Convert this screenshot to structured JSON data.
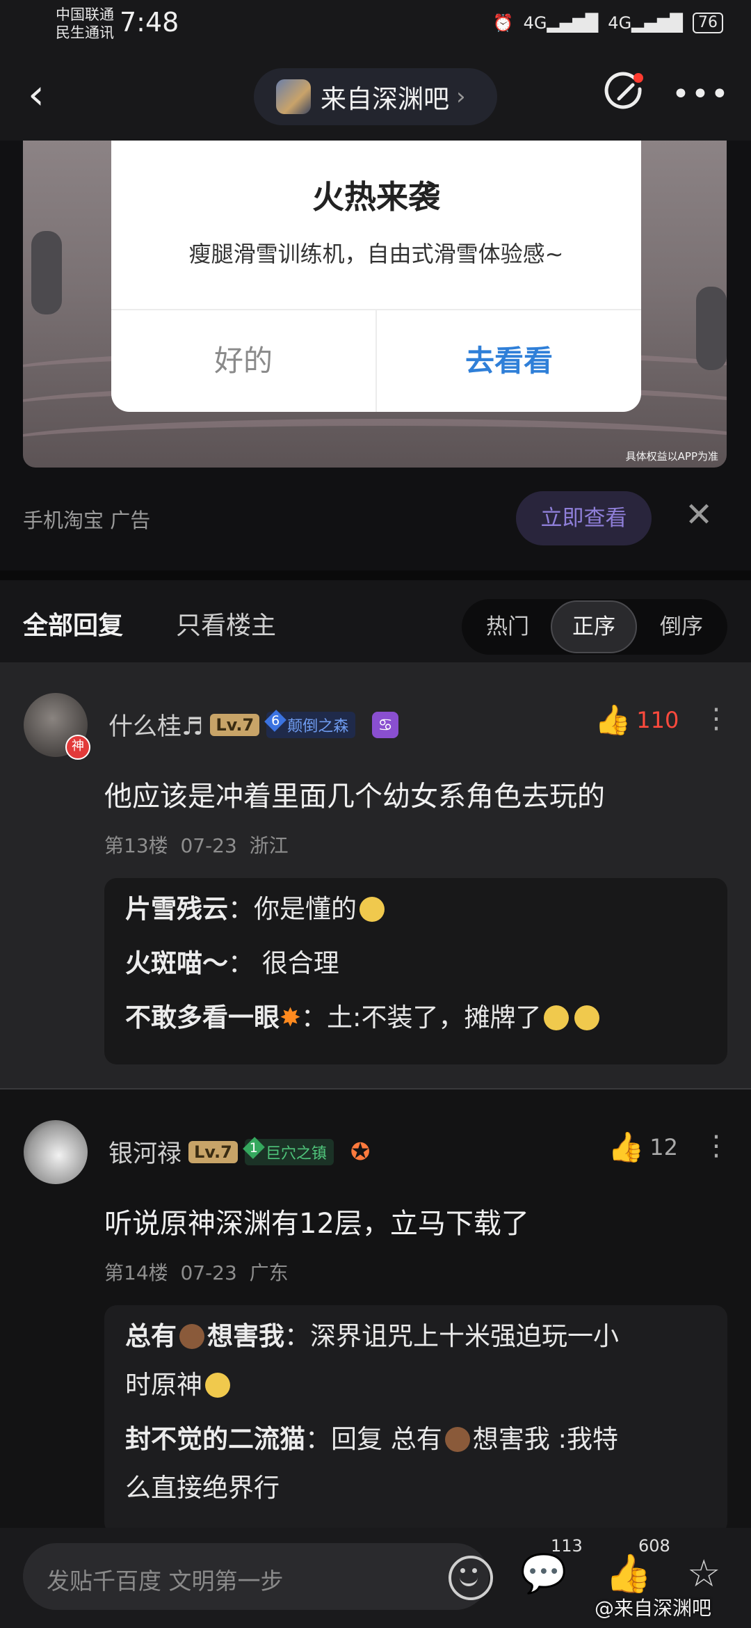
{
  "status_bar": {
    "carrier_line1": "中国联通",
    "carrier_line2": "民生通讯",
    "time": "7:48",
    "network1": "4G",
    "network2": "4G",
    "battery": "76"
  },
  "nav": {
    "forum_name": "来自深渊吧",
    "forum_chevron": "›",
    "back_icon": "chevron-left-icon",
    "compose_icon": "compose-icon",
    "more_icon": "more-icon"
  },
  "ad": {
    "dialog_title": "火热来袭",
    "dialog_text": "瘦腿滑雪训练机，自由式滑雪体验感~",
    "dialog_ok": "好的",
    "dialog_go": "去看看",
    "image_note": "具体权益以APP为准",
    "source": "手机淘宝  广告",
    "cta": "立即查看"
  },
  "tabs": {
    "all": "全部回复",
    "op_only": "只看楼主",
    "sort": [
      "热门",
      "正序",
      "倒序"
    ],
    "sort_active": "正序"
  },
  "replies": [
    {
      "username": "什么桂♬",
      "level": "Lv.7",
      "badge_num": "6",
      "badge_name": "颠倒之森",
      "likes": "110",
      "content": "他应该是冲着里面几个幼女系角色去玩的",
      "floor": "第13楼",
      "date": "07-23",
      "region": "浙江",
      "avatar_tag": "神",
      "subs": [
        {
          "name": "片雪残云",
          "text": "你是懂的"
        },
        {
          "name": "火斑喵～",
          "text": "很合理"
        },
        {
          "name": "不敢多看一眼",
          "text": "土:不装了，摊牌了"
        }
      ]
    },
    {
      "username": "银河禄",
      "level": "Lv.7",
      "badge_num": "1",
      "badge_name": "巨穴之镇",
      "likes": "12",
      "content": "听说原神深渊有12层，立马下载了",
      "floor": "第14楼",
      "date": "07-23",
      "region": "广东",
      "subs": [
        {
          "name": "总有",
          "name2": "想害我",
          "text": "深界诅咒上十米强迫玩一小",
          "text2": "时原神"
        },
        {
          "name": "封不觉的二流猫",
          "text": "回复 总有",
          "text_b": "想害我 :我特",
          "text2": "么直接绝界行"
        }
      ]
    }
  ],
  "bottom_bar": {
    "placeholder": "发贴千百度 文明第一步",
    "comments": "113",
    "likes": "608",
    "watermark": "@来自深渊吧"
  }
}
